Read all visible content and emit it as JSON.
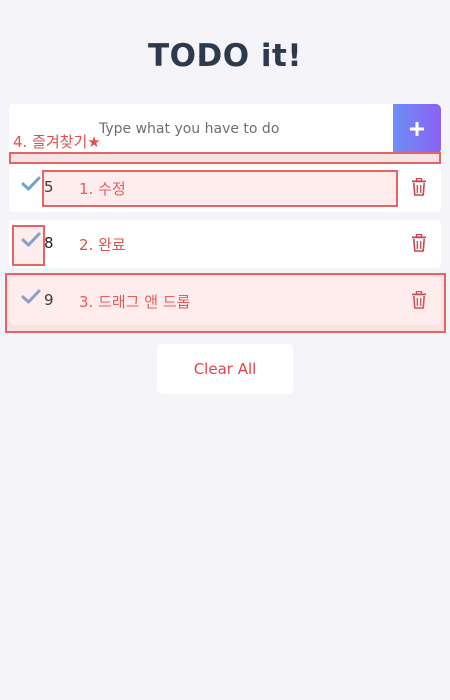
{
  "app": {
    "title": "TODO it!"
  },
  "input": {
    "placeholder": "Type what you have to do",
    "value": "",
    "add_icon": "plus-icon"
  },
  "annotations": {
    "favorites_label": "4. 즐겨찾기★"
  },
  "todos": [
    {
      "number": "5",
      "text": "1. 수정",
      "checked": true
    },
    {
      "number": "8",
      "text": "2. 완료",
      "checked": true
    },
    {
      "number": "9",
      "text": "3. 드래그 앤 드롭",
      "checked": true
    }
  ],
  "footer": {
    "clear_label": "Clear All"
  },
  "colors": {
    "background": "#f5f4f8",
    "title": "#2c3a4b",
    "accent_gradient_start": "#6c8ef5",
    "accent_gradient_end": "#8a63f3",
    "check": "#6fa3d6",
    "annotation": "#e34f4f",
    "trash": "#c9474f",
    "clear_text": "#e0454a"
  }
}
